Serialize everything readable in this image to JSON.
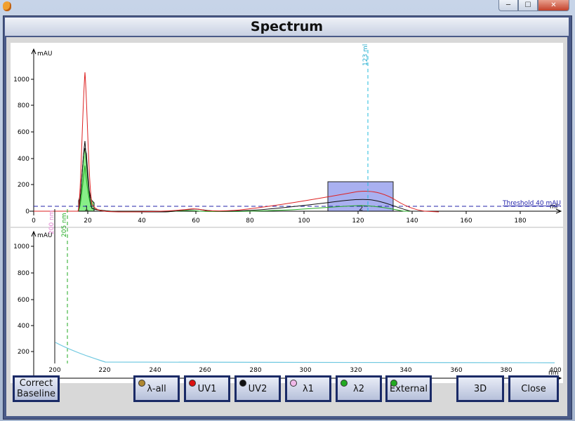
{
  "window": {
    "title": "Spectrum",
    "min": "─",
    "max": "☐",
    "close": "✕"
  },
  "top_plot": {
    "y_unit": "mAU",
    "x_unit": "ml",
    "y_ticks": [
      "0",
      "200",
      "400",
      "600",
      "800",
      "1000"
    ],
    "x_ticks": [
      "0",
      "20",
      "40",
      "60",
      "80",
      "100",
      "120",
      "140",
      "160",
      "180"
    ],
    "threshold_label": "Threshold 40 mAU",
    "marker_label": "123 ml",
    "fraction_labels": [
      "1",
      "2"
    ]
  },
  "bottom_plot": {
    "y_unit": "mAU",
    "x_unit": "nm",
    "y_ticks": [
      "0",
      "200",
      "400",
      "600",
      "800",
      "1000"
    ],
    "x_ticks": [
      "200",
      "220",
      "240",
      "260",
      "280",
      "300",
      "320",
      "340",
      "360",
      "380",
      "400"
    ],
    "marker1_label": "200 nm",
    "marker2_label": "205 nm"
  },
  "buttons": {
    "correct_baseline": "Correct Baseline",
    "lambda_all": "λ-all",
    "uv1": "UV1",
    "uv2": "UV2",
    "lambda1": "λ1",
    "lambda2": "λ2",
    "external": "External",
    "three_d": "3D",
    "close": "Close"
  },
  "colors": {
    "uv1": "#dd1111",
    "uv2": "#111111",
    "lambda1": "#e080d0",
    "lambda2": "#22aa22",
    "lambda_all": "#b08830",
    "external": "#22aa22",
    "threshold": "#2222aa",
    "marker": "#22bbdd",
    "spectrum": "#6ec8e0",
    "fraction1": "#88ee88",
    "fraction2": "#a9b0f0"
  }
}
